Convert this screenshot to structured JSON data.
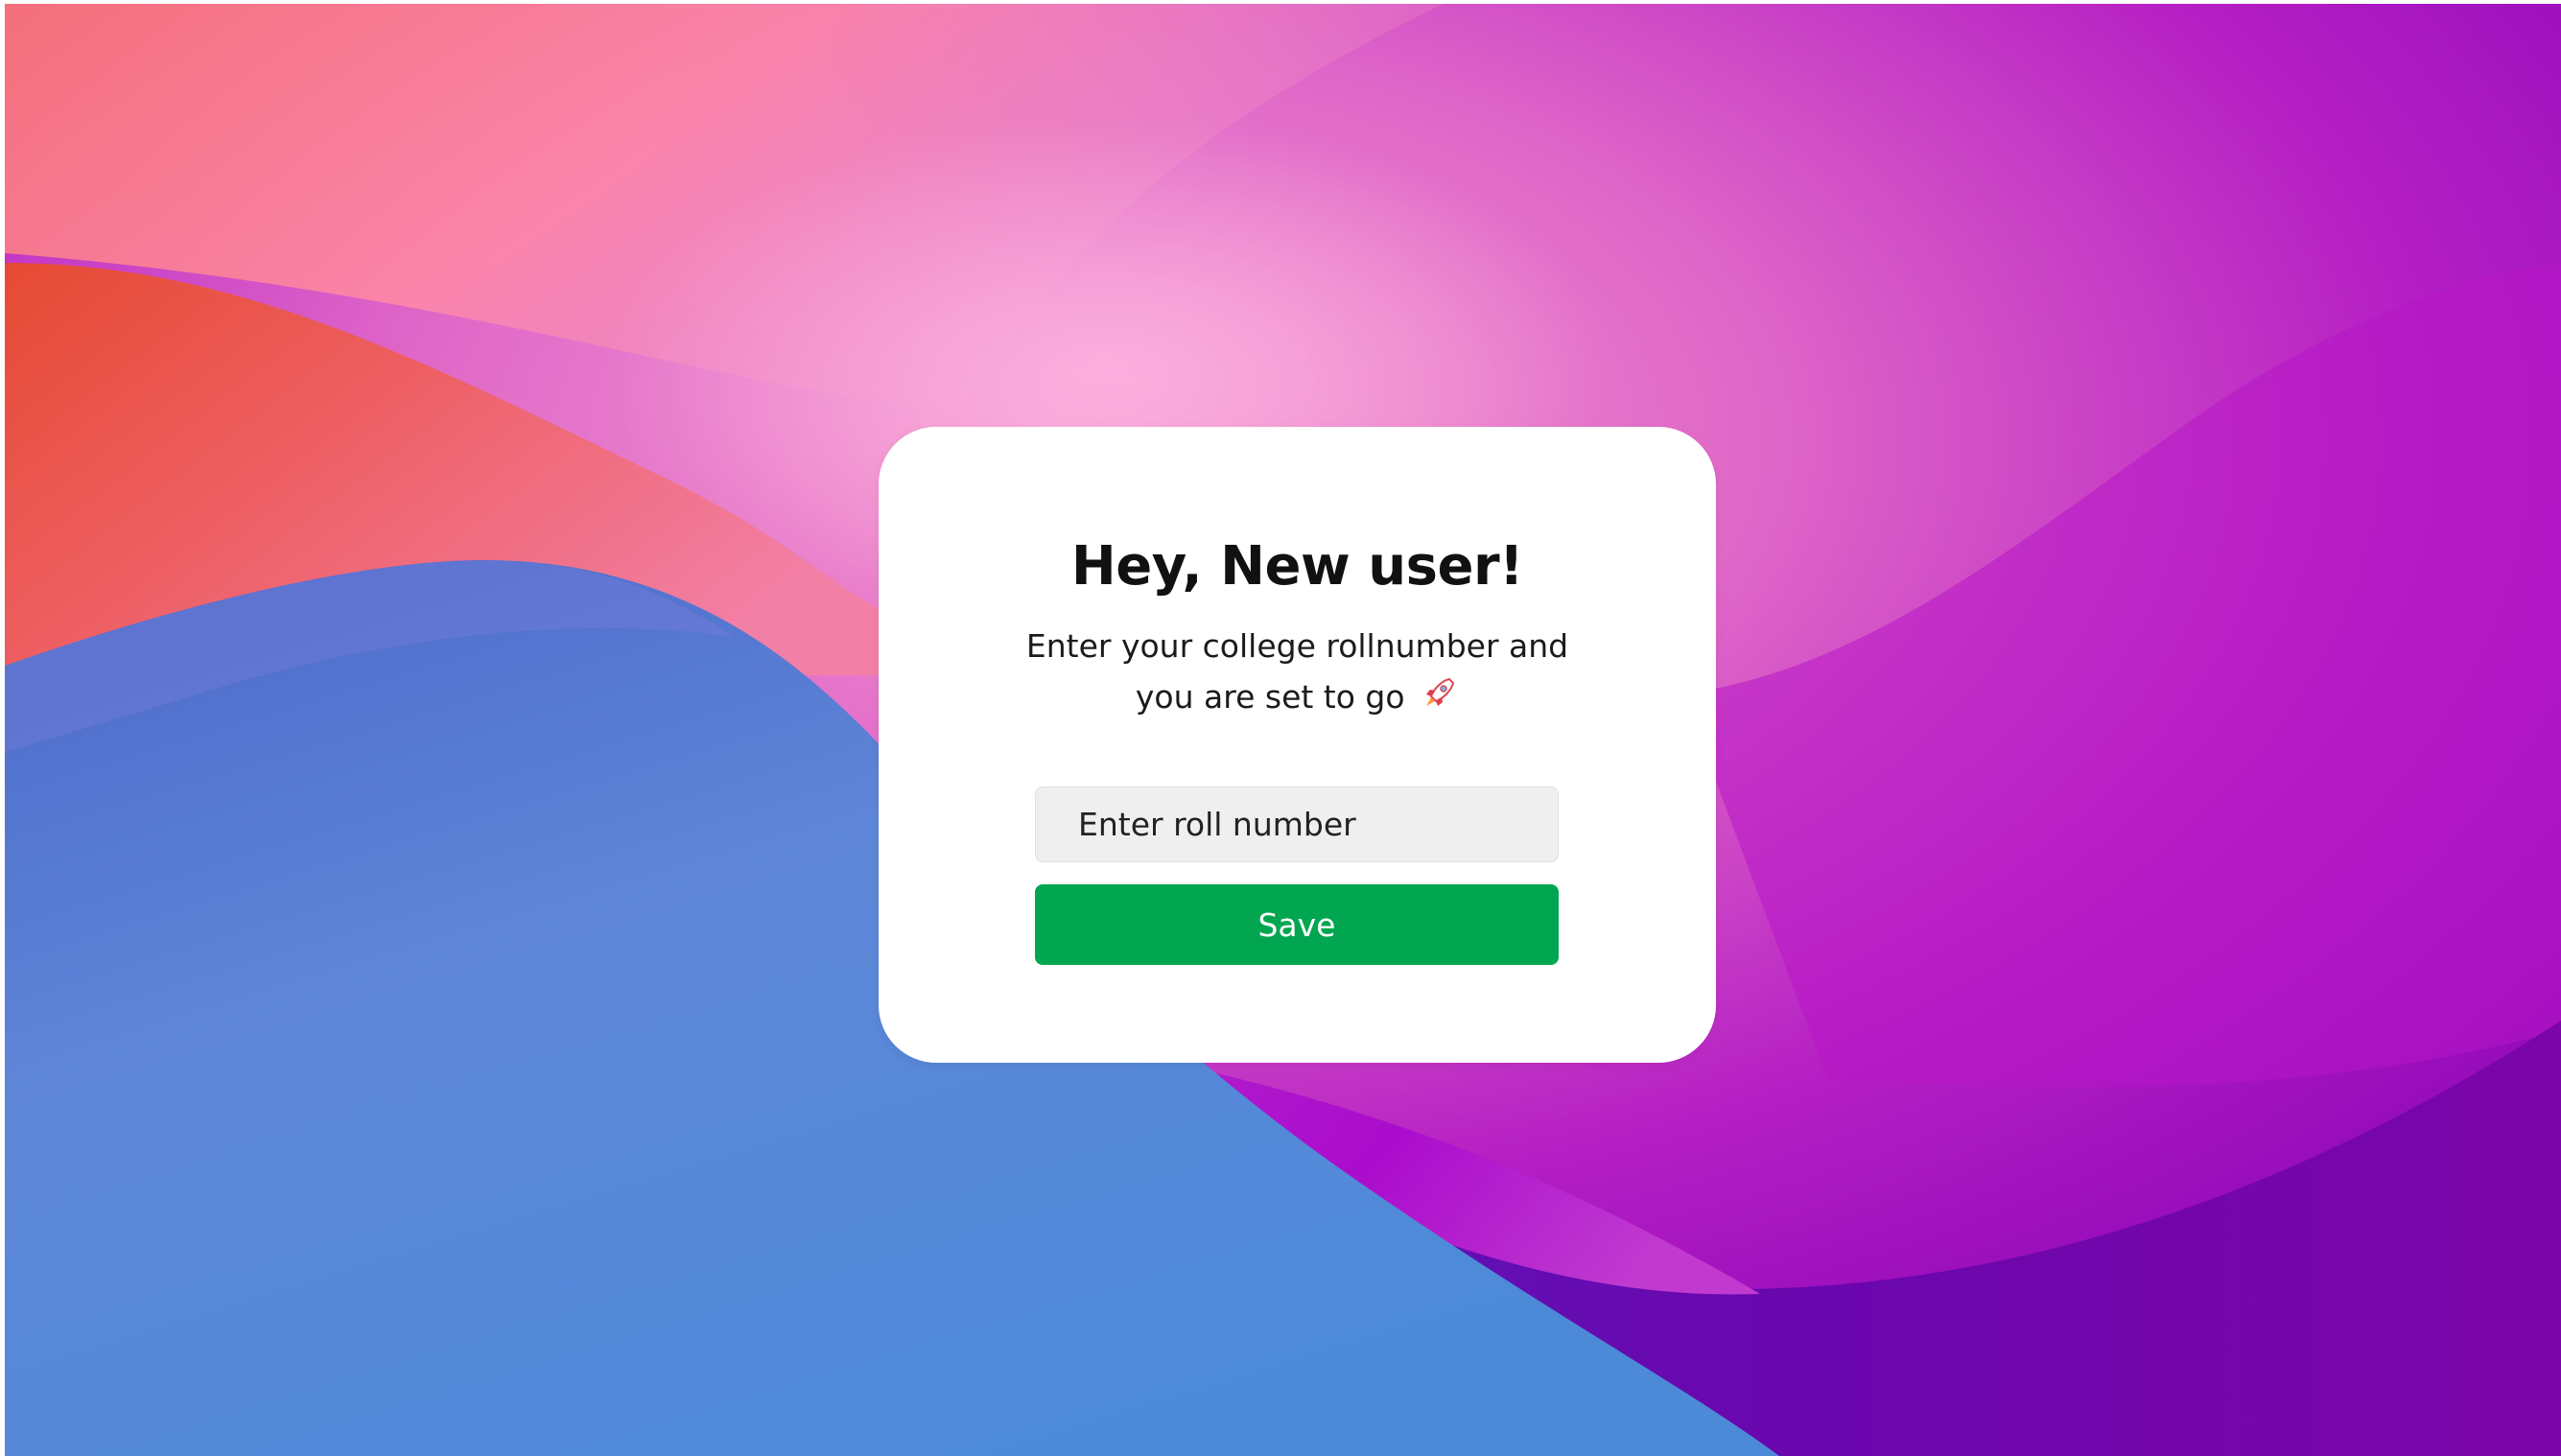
{
  "page": {
    "title": "Hey, New user!",
    "subtitle": "Enter your college rollnumber and you are set to go",
    "subtitle_icon": "rocket-icon"
  },
  "form": {
    "roll_number": {
      "value": "",
      "placeholder": "Enter roll number"
    },
    "save_label": "Save"
  },
  "colors": {
    "save_button": "#03a650",
    "card_background": "#ffffff",
    "input_background": "#efefef",
    "wallpaper_pink": "#f58ec6",
    "wallpaper_purple": "#9b06c8",
    "wallpaper_blue": "#4f84d6",
    "wallpaper_orange": "#e8553a"
  }
}
